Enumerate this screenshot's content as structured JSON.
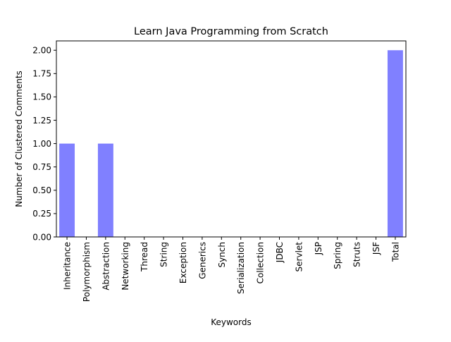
{
  "chart_data": {
    "type": "bar",
    "title": "Learn Java Programming from Scratch",
    "xlabel": "Keywords",
    "ylabel": "Number of Clustered Comments",
    "categories": [
      "Inheritance",
      "Polymorphism",
      "Abstraction",
      "Networking",
      "Thread",
      "String",
      "Exception",
      "Generics",
      "Synch",
      "Serialization",
      "Collection",
      "JDBC",
      "Servlet",
      "JSP",
      "Spring",
      "Struts",
      "JSF",
      "Total"
    ],
    "values": [
      1,
      0,
      1,
      0,
      0,
      0,
      0,
      0,
      0,
      0,
      0,
      0,
      0,
      0,
      0,
      0,
      0,
      2
    ],
    "ylim": [
      0,
      2.1
    ],
    "yticks": [
      "0.00",
      "0.25",
      "0.50",
      "0.75",
      "1.00",
      "1.25",
      "1.50",
      "1.75",
      "2.00"
    ],
    "grid": false,
    "bar_color": "#8080ff"
  }
}
